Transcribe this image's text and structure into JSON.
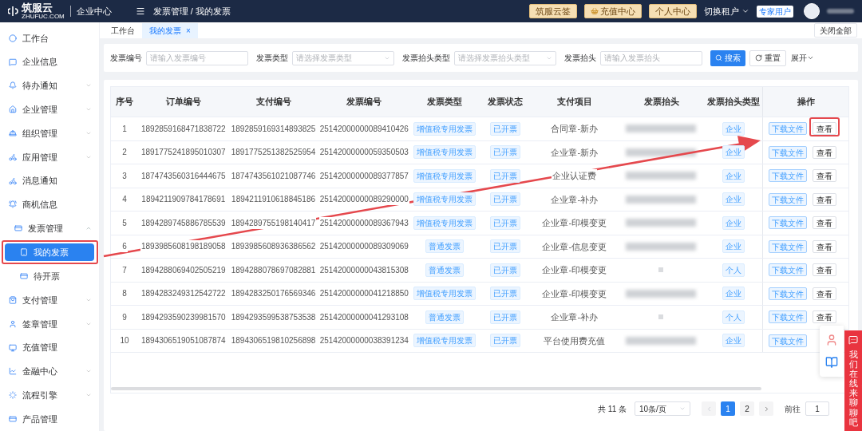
{
  "header": {
    "brand": "筑服云",
    "brand_sub": "ZHUFUC.COM",
    "center": "企业中心",
    "breadcrumb": "发票管理 / 我的发票",
    "buttons": [
      {
        "label": "筑服云签",
        "kind": "plain"
      },
      {
        "label": "充值中心",
        "kind": "icon"
      },
      {
        "label": "个人中心",
        "kind": "plain"
      }
    ],
    "tenant_switch": {
      "label": "切换租户",
      "expanded": false
    },
    "user_badge": "专家用户"
  },
  "sidebar": {
    "items": [
      {
        "label": "工作台",
        "expandable": false
      },
      {
        "label": "企业信息",
        "expandable": false
      },
      {
        "label": "待办通知",
        "expandable": true
      },
      {
        "label": "企业管理",
        "expandable": true
      },
      {
        "label": "组织管理",
        "expandable": true
      },
      {
        "label": "应用管理",
        "expandable": true
      },
      {
        "label": "消息通知",
        "expandable": false
      },
      {
        "label": "商机信息",
        "expandable": false
      },
      {
        "label": "发票管理",
        "expandable": true,
        "expanded": true,
        "children": [
          {
            "label": "我的发票",
            "selected": true
          },
          {
            "label": "待开票",
            "selected": false
          }
        ]
      },
      {
        "label": "支付管理",
        "expandable": true
      },
      {
        "label": "签章管理",
        "expandable": true
      },
      {
        "label": "充值管理",
        "expandable": false
      },
      {
        "label": "金融中心",
        "expandable": true
      },
      {
        "label": "流程引擎",
        "expandable": true
      },
      {
        "label": "产品管理",
        "expandable": false
      }
    ]
  },
  "tabs": [
    {
      "label": "工作台",
      "selected": false,
      "closable": false
    },
    {
      "label": "我的发票",
      "selected": true,
      "closable": true,
      "close": "×"
    }
  ],
  "close_all": "关闭全部",
  "filters": [
    {
      "label": "发票编号",
      "kind": "input",
      "placeholder": "请输入发票编号"
    },
    {
      "label": "发票类型",
      "kind": "select",
      "placeholder": "请选择发票类型"
    },
    {
      "label": "发票抬头类型",
      "kind": "select",
      "placeholder": "请选择发票抬头类型"
    },
    {
      "label": "发票抬头",
      "kind": "input",
      "placeholder": "请输入发票抬头"
    }
  ],
  "search_button": "搜索",
  "reset_button": "重置",
  "expand_toggle": "展开",
  "table": {
    "columns": [
      "序号",
      "订单编号",
      "支付编号",
      "发票编号",
      "发票类型",
      "发票状态",
      "支付项目",
      "发票抬头",
      "发票抬头类型",
      "操作"
    ],
    "rows": [
      {
        "no": "1",
        "order_no": "1892859168471838722",
        "pay_no": "1892859169314893825",
        "invoice_no": "25142000000089410426",
        "invoice_type": "增值税专用发票",
        "status": "已开票",
        "item": "合同章-新办",
        "header": {
          "kind": "blur"
        },
        "header_type": "企业",
        "actions": [
          "下载文件",
          "查看"
        ]
      },
      {
        "no": "2",
        "order_no": "1891775241895010307",
        "pay_no": "1891775251382525954",
        "invoice_no": "25142000000059350503",
        "invoice_type": "增值税专用发票",
        "status": "已开票",
        "item": "企业章-新办",
        "header": {
          "kind": "blur"
        },
        "header_type": "企业",
        "actions": [
          "下载文件",
          "查看"
        ]
      },
      {
        "no": "3",
        "order_no": "1874743560316444675",
        "pay_no": "1874743561021087746",
        "invoice_no": "25142000000089377857",
        "invoice_type": "增值税专用发票",
        "status": "已开票",
        "item": "企业认证费",
        "header": {
          "kind": "blur"
        },
        "header_type": "企业",
        "actions": [
          "下载文件",
          "查看"
        ]
      },
      {
        "no": "4",
        "order_no": "1894211909784178691",
        "pay_no": "1894211910618845186",
        "invoice_no": "25142000000089290000",
        "invoice_type": "增值税专用发票",
        "status": "已开票",
        "item": "企业章-补办",
        "header": {
          "kind": "blur"
        },
        "header_type": "企业",
        "actions": [
          "下载文件",
          "查看"
        ]
      },
      {
        "no": "5",
        "order_no": "1894289745886785539",
        "pay_no": "1894289755198140417",
        "invoice_no": "25142000000089367943",
        "invoice_type": "增值税专用发票",
        "status": "已开票",
        "item": "企业章-印模变更",
        "header": {
          "kind": "blur"
        },
        "header_type": "企业",
        "actions": [
          "下载文件",
          "查看"
        ]
      },
      {
        "no": "6",
        "order_no": "1893985608198189058",
        "pay_no": "1893985608936386562",
        "invoice_no": "25142000000089309069",
        "invoice_type": "普通发票",
        "status": "已开票",
        "item": "企业章-信息变更",
        "header": {
          "kind": "blur"
        },
        "header_type": "企业",
        "actions": [
          "下载文件",
          "查看"
        ]
      },
      {
        "no": "7",
        "order_no": "1894288069402505219",
        "pay_no": "1894288078697082881",
        "invoice_no": "25142000000043815308",
        "invoice_type": "普通发票",
        "status": "已开票",
        "item": "企业章-印模变更",
        "header": {
          "kind": "dot"
        },
        "header_type": "个人",
        "actions": [
          "下载文件",
          "查看"
        ]
      },
      {
        "no": "8",
        "order_no": "1894283249312542722",
        "pay_no": "1894283250176569346",
        "invoice_no": "25142000000041218850",
        "invoice_type": "增值税专用发票",
        "status": "已开票",
        "item": "企业章-印模变更",
        "header": {
          "kind": "blur"
        },
        "header_type": "企业",
        "actions": [
          "下载文件",
          "查看"
        ]
      },
      {
        "no": "9",
        "order_no": "1894293590239981570",
        "pay_no": "1894293599538753538",
        "invoice_no": "25142000000041293108",
        "invoice_type": "普通发票",
        "status": "已开票",
        "item": "企业章-补办",
        "header": {
          "kind": "dot"
        },
        "header_type": "个人",
        "actions": [
          "下载文件",
          "查看"
        ]
      },
      {
        "no": "10",
        "order_no": "1894306519051087874",
        "pay_no": "1894306519810256898",
        "invoice_no": "25142000000038391234",
        "invoice_type": "增值税专用发票",
        "status": "已开票",
        "item": "平台使用费充值",
        "header": {
          "kind": "blur"
        },
        "header_type": "企业",
        "actions": [
          "下载文件"
        ]
      }
    ]
  },
  "pagination": {
    "total": "共 11 条",
    "page_size": "10条/页",
    "pages": [
      {
        "label": "1",
        "selected": true
      },
      {
        "label": "2",
        "selected": false
      }
    ],
    "goto_label": "前往",
    "goto_value": "1"
  },
  "chat_bar": {
    "text": "我们在线，来聊聊吧"
  },
  "annotations": [
    {
      "kind": "arrow"
    },
    {
      "kind": "box"
    },
    {
      "kind": "box"
    }
  ]
}
